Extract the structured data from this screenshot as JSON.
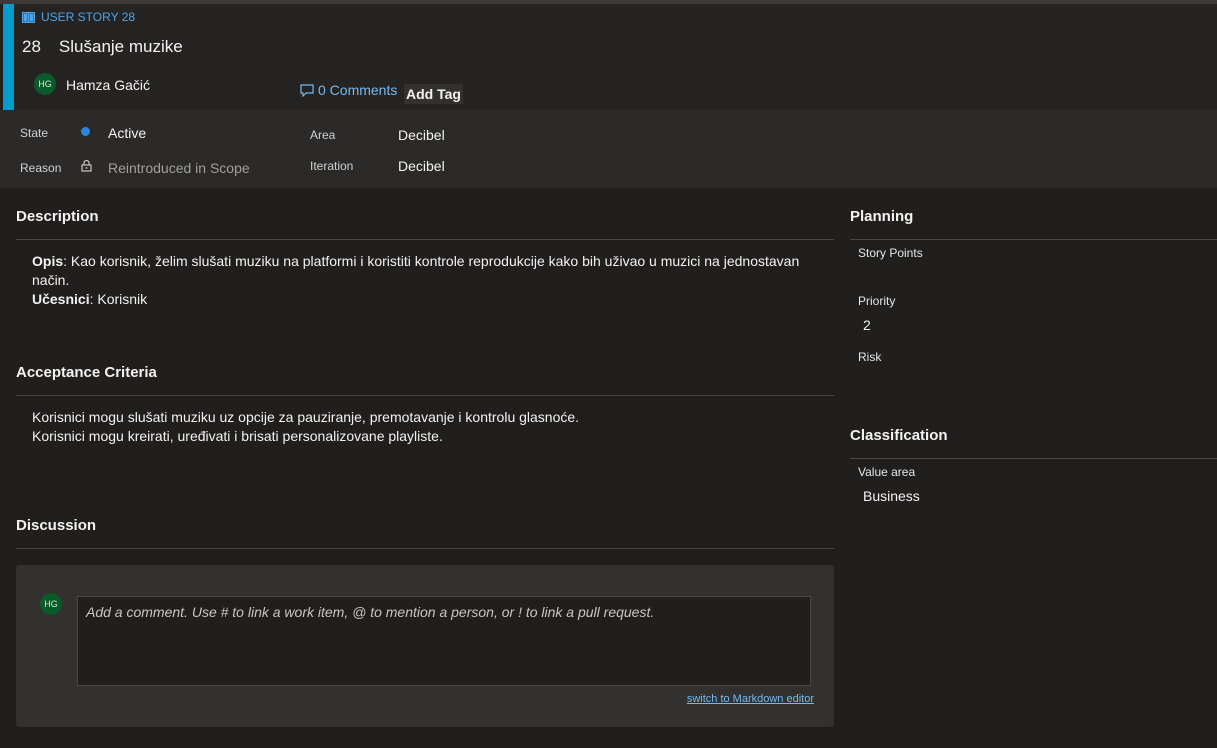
{
  "header": {
    "type_label": "USER STORY 28",
    "id": "28",
    "title": "Slušanje muzike",
    "assignee_initials": "HG",
    "assignee_name": "Hamza Gačić",
    "comments_label": "0 Comments",
    "add_tag_label": "Add Tag",
    "accent_color": "#009ccc"
  },
  "fields": {
    "state_label": "State",
    "state_value": "Active",
    "state_color": "#2886de",
    "reason_label": "Reason",
    "reason_value": "Reintroduced in Scope",
    "area_label": "Area",
    "area_value": "Decibel",
    "iteration_label": "Iteration",
    "iteration_value": "Decibel"
  },
  "description": {
    "title": "Description",
    "opis_label": "Opis",
    "opis_text": ": Kao korisnik, želim slušati muziku na platformi i koristiti kontrole reprodukcije kako bih uživao u muzici na jednostavan",
    "opis_text_cont": "način.",
    "ucesnici_label": "Učesnici",
    "ucesnici_text": ": Korisnik"
  },
  "acceptance": {
    "title": "Acceptance Criteria",
    "lines": [
      "Korisnici mogu slušati muziku uz opcije za pauziranje, premotavanje i kontrolu glasnoće.",
      "Korisnici mogu kreirati, uređivati i brisati personalizovane playliste."
    ]
  },
  "discussion": {
    "title": "Discussion",
    "avatar_initials": "HG",
    "placeholder": "Add a comment. Use # to link a work item, @ to mention a person, or ! to link a pull request.",
    "markdown_link": "switch to Markdown editor"
  },
  "planning": {
    "title": "Planning",
    "story_points_label": "Story Points",
    "story_points_value": "",
    "priority_label": "Priority",
    "priority_value": "2",
    "risk_label": "Risk",
    "risk_value": ""
  },
  "classification": {
    "title": "Classification",
    "value_area_label": "Value area",
    "value_area_value": "Business"
  }
}
